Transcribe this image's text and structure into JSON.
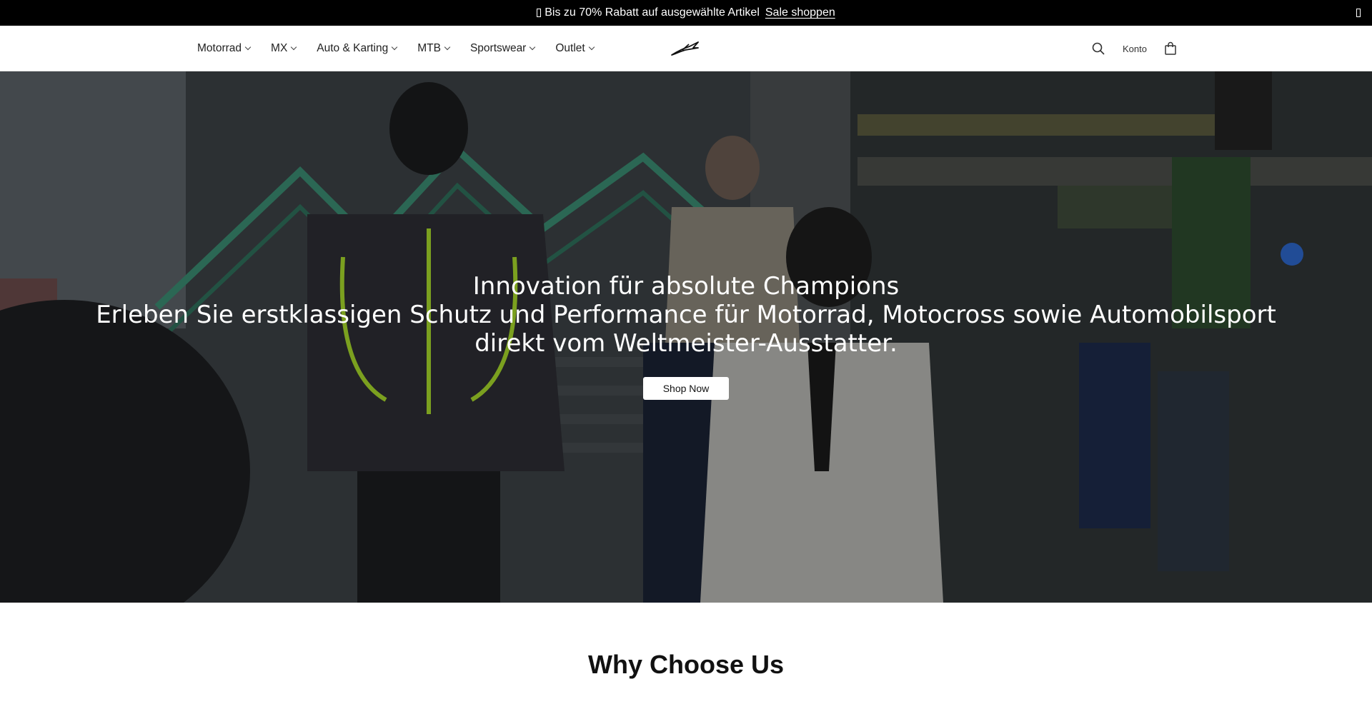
{
  "announcement": {
    "text": "Bis zu 70% Rabatt auf ausgewählte Artikel",
    "link": "Sale shoppen",
    "icon": "gift-icon"
  },
  "nav": {
    "items": [
      {
        "label": "Motorrad"
      },
      {
        "label": "MX"
      },
      {
        "label": "Auto & Karting"
      },
      {
        "label": "MTB"
      },
      {
        "label": "Sportswear"
      },
      {
        "label": "Outlet"
      }
    ]
  },
  "header": {
    "logo_icon": "alpinestars-star-logo",
    "account_label": "Konto",
    "search_icon": "search-icon",
    "cart_icon": "shopping-bag-icon"
  },
  "hero": {
    "title": "Innovation für absolute Champions",
    "subtitle": "Erleben Sie erstklassigen Schutz und Performance für Motorrad, Motocross sowie Automobilsport direkt vom Weltmeister-Ausstatter.",
    "cta_label": "Shop Now"
  },
  "section": {
    "title": "Why Choose Us"
  }
}
